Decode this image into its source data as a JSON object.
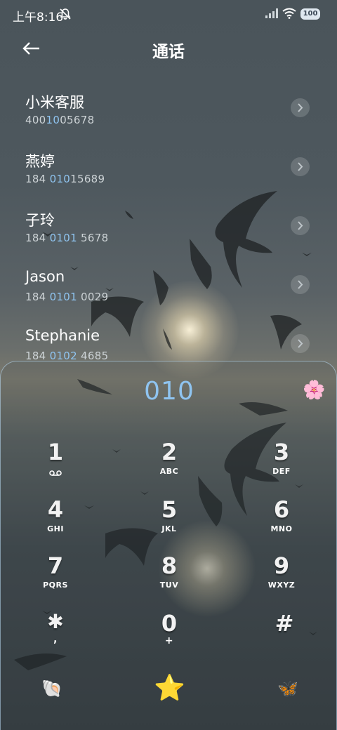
{
  "status_bar": {
    "time": "上午8:16",
    "battery": "100"
  },
  "header": {
    "title": "通话"
  },
  "contacts": [
    {
      "name": "小米客服",
      "number_pre": "400",
      "number_hl": "10",
      "number_post": "05678"
    },
    {
      "name": "燕婷",
      "number_pre": "184 ",
      "number_hl": "010",
      "number_post": "15689"
    },
    {
      "name": "子玲",
      "number_pre": "184 ",
      "number_hl": "0101",
      "number_post": " 5678"
    },
    {
      "name": "Jason",
      "number_pre": "184 ",
      "number_hl": "0101",
      "number_post": " 0029"
    },
    {
      "name": "Stephanie",
      "number_pre": "184 ",
      "number_hl": "0102",
      "number_post": " 4685"
    }
  ],
  "dialpad": {
    "display": "010",
    "keys": [
      {
        "digit": "1",
        "letters": ""
      },
      {
        "digit": "2",
        "letters": "ABC"
      },
      {
        "digit": "3",
        "letters": "DEF"
      },
      {
        "digit": "4",
        "letters": "GHI"
      },
      {
        "digit": "5",
        "letters": "JKL"
      },
      {
        "digit": "6",
        "letters": "MNO"
      },
      {
        "digit": "7",
        "letters": "PQRS"
      },
      {
        "digit": "8",
        "letters": "TUV"
      },
      {
        "digit": "9",
        "letters": "WXYZ"
      },
      {
        "digit": "✱",
        "letters": ","
      },
      {
        "digit": "0",
        "letters": "+"
      },
      {
        "digit": "#",
        "letters": ""
      }
    ]
  },
  "icons": {
    "flower": "🌸",
    "shell": "🐚",
    "star": "⭐",
    "butterfly": "🦋",
    "voicemail": "voicemail-icon"
  },
  "colors": {
    "accent": "#8fc4f0"
  }
}
